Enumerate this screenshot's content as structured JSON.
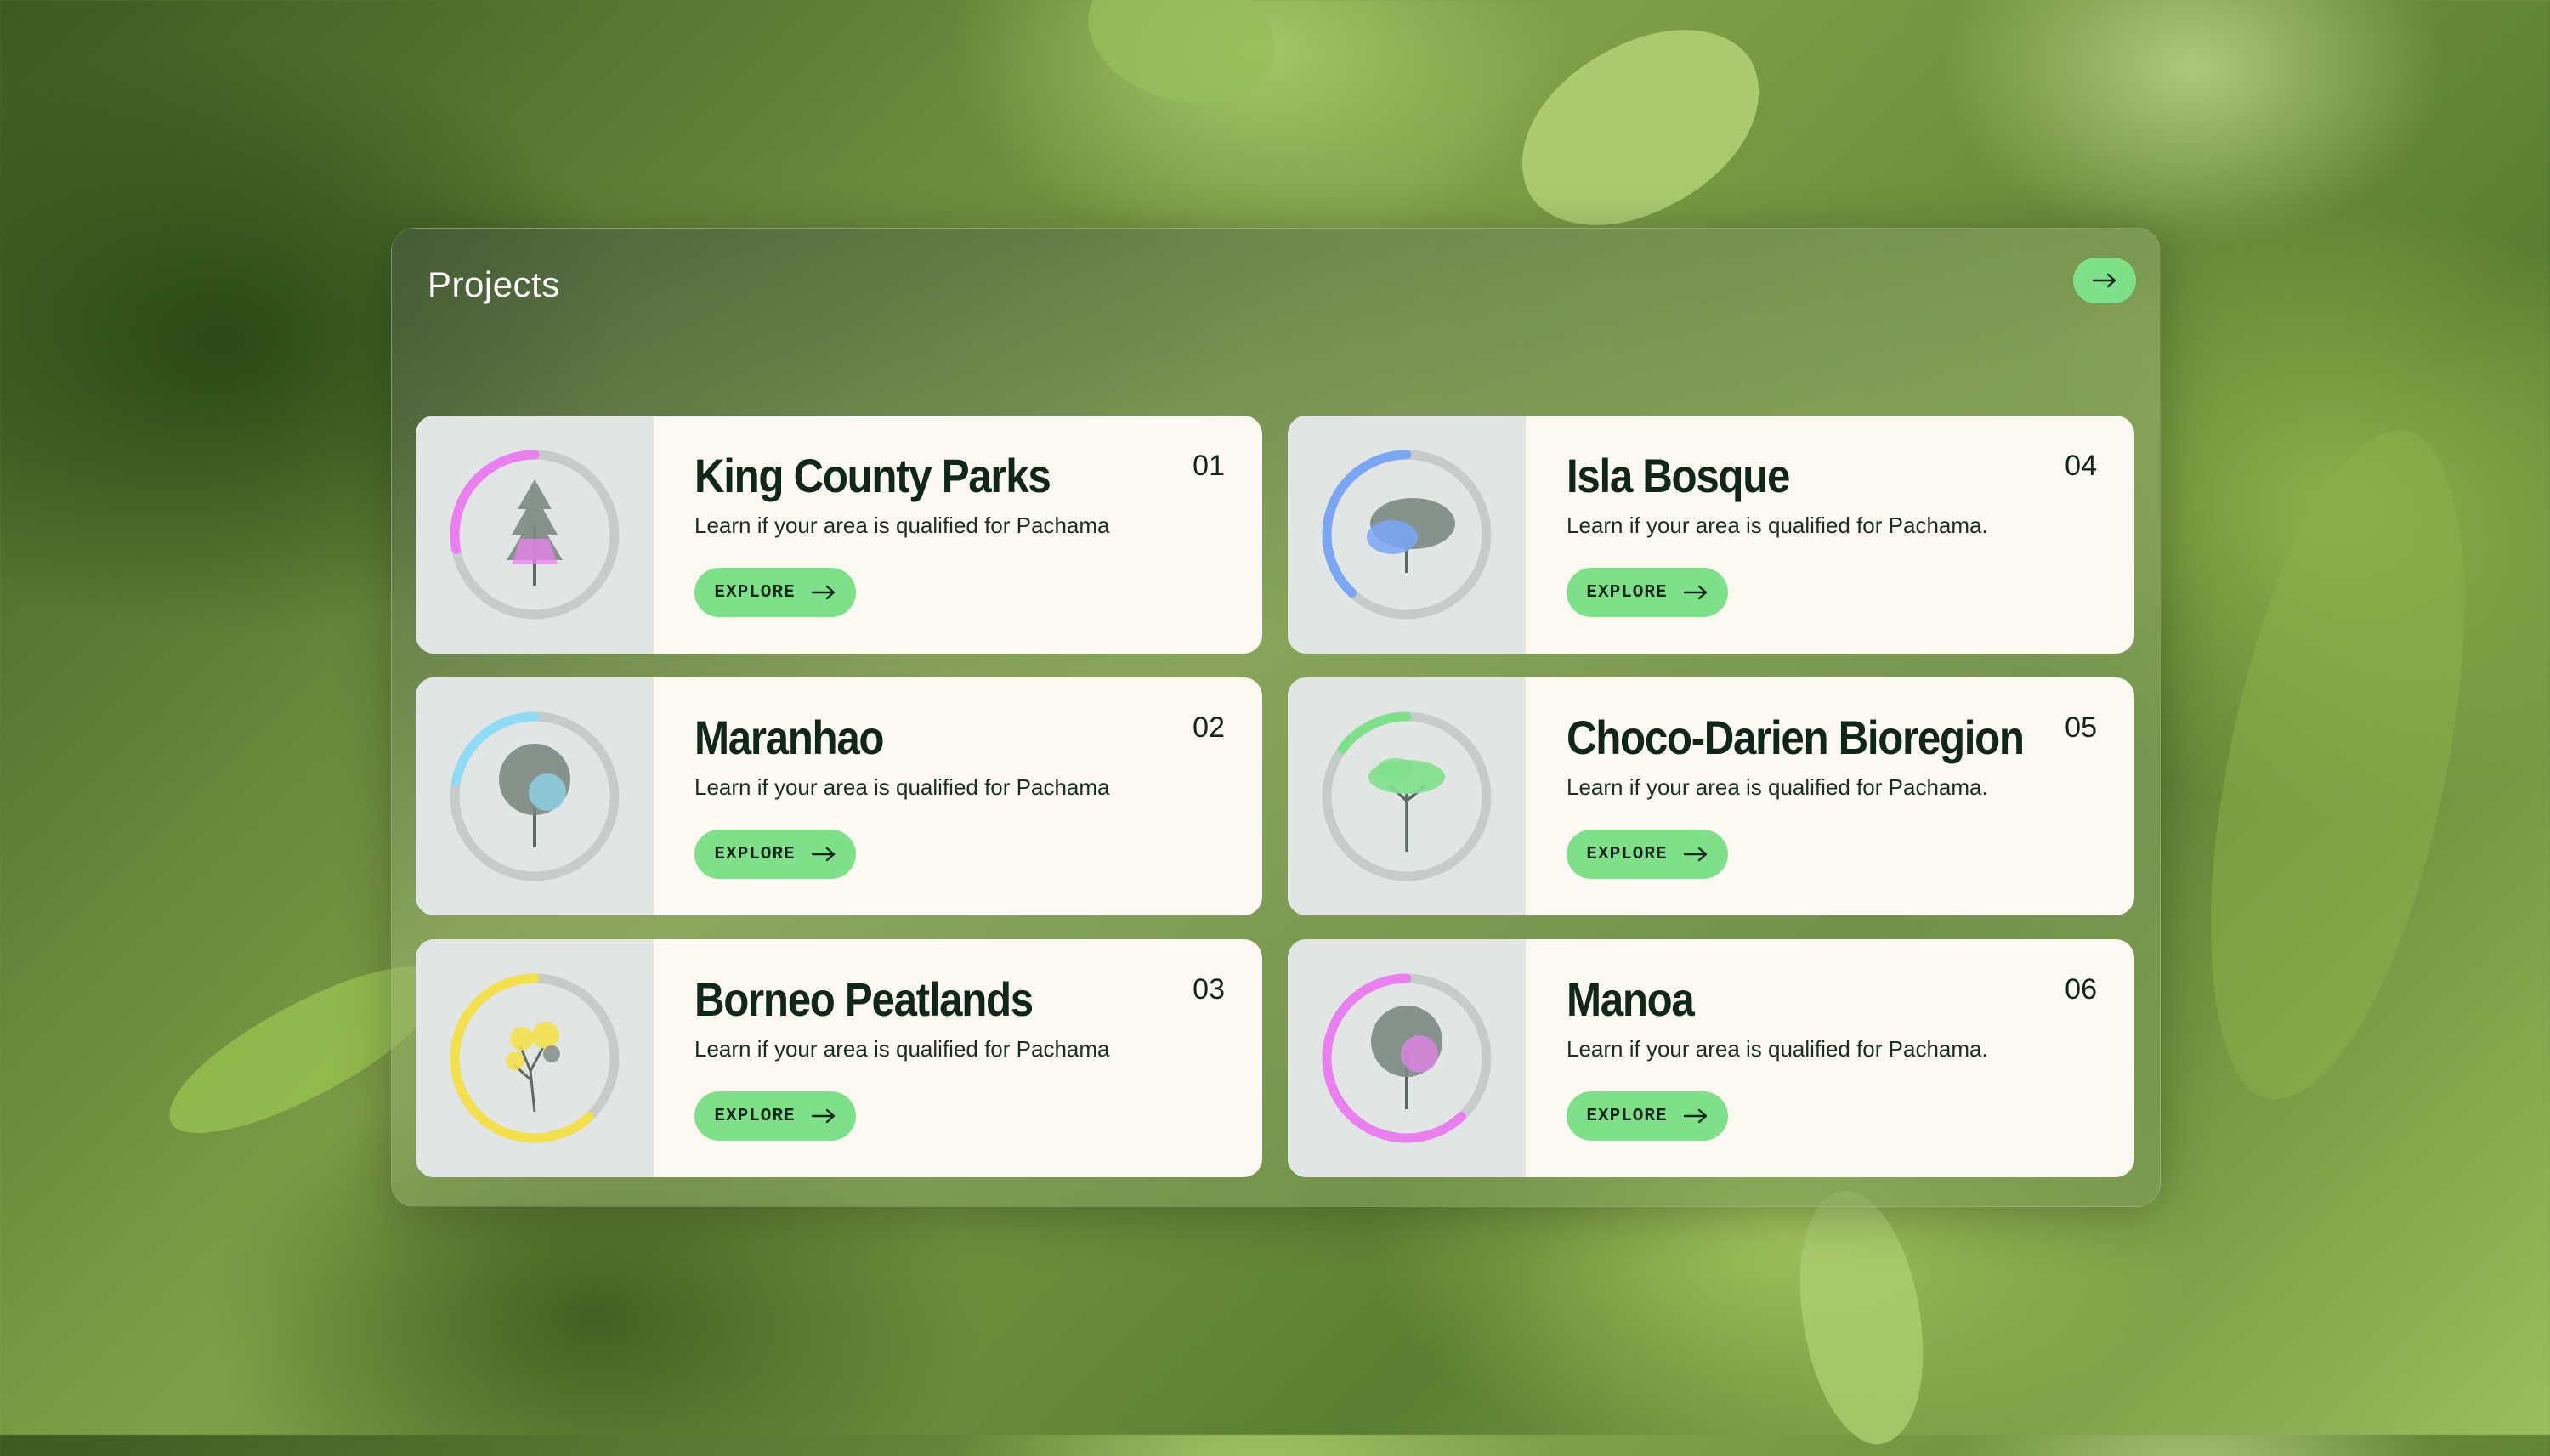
{
  "panel": {
    "title": "Projects"
  },
  "projects": [
    {
      "title": "King County Parks",
      "number": "01",
      "description": "Learn if your area is qualified for Pachama",
      "button": "EXPLORE",
      "accent": "#ea80f0",
      "progress": 0.28,
      "tree": "conifer"
    },
    {
      "title": "Maranhao",
      "number": "02",
      "description": "Learn if your area is qualified for Pachama",
      "button": "EXPLORE",
      "accent": "#8fdcf7",
      "progress": 0.22,
      "tree": "round"
    },
    {
      "title": "Borneo Peatlands",
      "number": "03",
      "description": "Learn if your area is qualified for Pachama",
      "button": "EXPLORE",
      "accent": "#f4e04a",
      "progress": 0.62,
      "tree": "sparse"
    },
    {
      "title": "Isla Bosque",
      "number": "04",
      "description": "Learn if your area is qualified for Pachama.",
      "button": "EXPLORE",
      "accent": "#7aa6f5",
      "progress": 0.38,
      "tree": "broad"
    },
    {
      "title": "Choco-Darien Bioregion",
      "number": "05",
      "description": "Learn if your area is qualified for Pachama.",
      "button": "EXPLORE",
      "accent": "#7fe08a",
      "progress": 0.15,
      "tree": "umbrella"
    },
    {
      "title": "Manoa",
      "number": "06",
      "description": "Learn if your area is qualified for Pachama.",
      "button": "EXPLORE",
      "accent": "#ea80f0",
      "progress": 0.62,
      "tree": "round"
    }
  ]
}
